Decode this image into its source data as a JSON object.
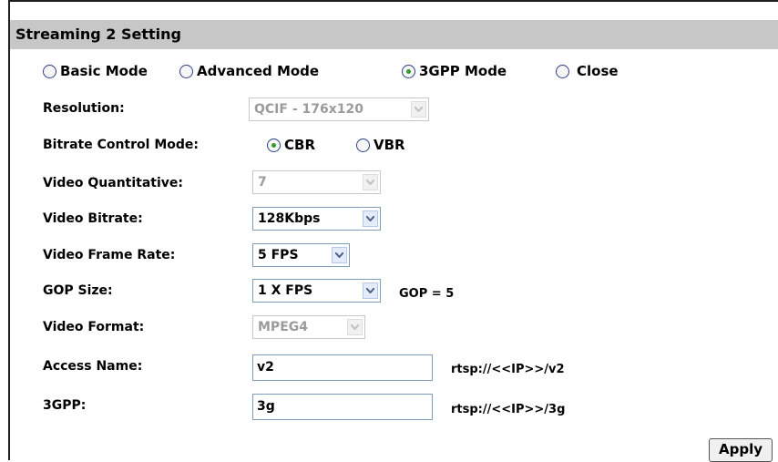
{
  "header": {
    "title": "Streaming 2 Setting"
  },
  "modes": [
    {
      "label": "Basic Mode",
      "checked": false
    },
    {
      "label": "Advanced Mode",
      "checked": false
    },
    {
      "label": "3GPP Mode",
      "checked": true
    },
    {
      "label": "Close",
      "checked": false
    }
  ],
  "resolution": {
    "label": "Resolution:",
    "value": "QCIF - 176x120",
    "disabled": true
  },
  "bitrate_mode": {
    "label": "Bitrate Control Mode:",
    "options": [
      {
        "label": "CBR",
        "checked": true
      },
      {
        "label": "VBR",
        "checked": false
      }
    ]
  },
  "quantitative": {
    "label": "Video Quantitative:",
    "value": "7",
    "disabled": true
  },
  "video_bitrate": {
    "label": "Video Bitrate:",
    "value": "128Kbps"
  },
  "frame_rate": {
    "label": "Video Frame Rate:",
    "value": "5 FPS"
  },
  "gop": {
    "label": "GOP Size:",
    "value": "1 X FPS",
    "note": "GOP = 5"
  },
  "video_format": {
    "label": "Video Format:",
    "value": "MPEG4",
    "disabled": true
  },
  "access_name": {
    "label": "Access Name:",
    "value": "v2",
    "url": "rtsp://<<IP>>/v2"
  },
  "threegpp": {
    "label": "3GPP:",
    "value": "3g",
    "url": "rtsp://<<IP>>/3g"
  },
  "apply_label": "Apply"
}
